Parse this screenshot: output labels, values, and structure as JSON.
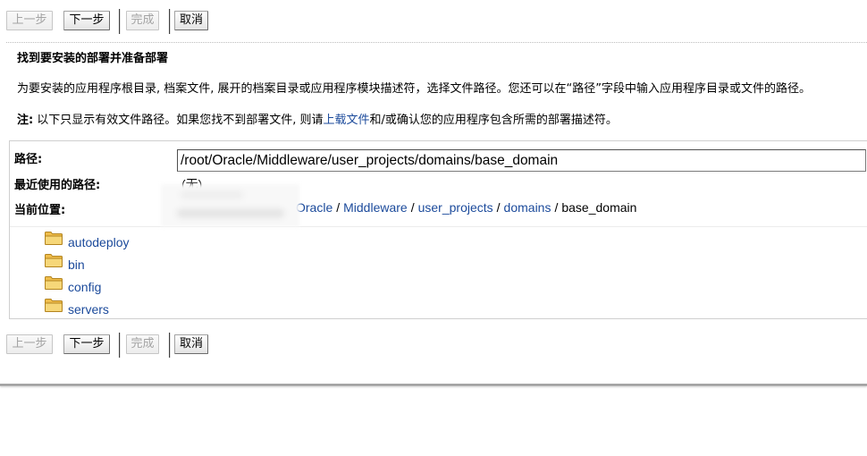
{
  "colors": {
    "link": "#1b4a9b",
    "disabled_text": "#a3a3a3",
    "folder": "#f6d779"
  },
  "toolbar_top": {
    "buttons": [
      {
        "label": "上一步",
        "disabled": true
      },
      {
        "label": "下一步",
        "disabled": false
      },
      {
        "label": "完成",
        "disabled": true
      },
      {
        "label": "取消",
        "disabled": false
      }
    ]
  },
  "header": {
    "title": "找到要安装的部署并准备部署",
    "description": "为要安装的应用程序根目录, 档案文件, 展开的档案目录或应用程序模块描述符，选择文件路径。您还可以在“路径”字段中输入应用程序目录或文件的路径。",
    "note": {
      "label": "注:",
      "text_before_link": "以下只显示有效文件路径。如果您找不到部署文件, 则请",
      "link": "上载文件",
      "text_after_link": "和/或确认您的应用程序包含所需的部署描述符。"
    }
  },
  "file_browser": {
    "path": {
      "label": "路径:",
      "value": "/root/Oracle/Middleware/user_projects/domains/base_domain"
    },
    "recent_paths": {
      "label": "最近使用的路径:",
      "value": "(无)"
    },
    "current_location": {
      "label": "当前位置:",
      "separator": "/",
      "crumbs": [
        {
          "label": "Oracle"
        },
        {
          "label": "Middleware"
        },
        {
          "label": "user_projects"
        },
        {
          "label": "domains"
        },
        {
          "label": "base_domain"
        }
      ]
    },
    "folders": [
      {
        "name": "autodeploy",
        "icon": "folder-icon"
      },
      {
        "name": "bin",
        "icon": "folder-icon"
      },
      {
        "name": "config",
        "icon": "folder-icon"
      },
      {
        "name": "servers",
        "icon": "folder-icon"
      }
    ]
  },
  "toolbar_bottom": {
    "buttons": [
      {
        "label": "上一步",
        "disabled": true
      },
      {
        "label": "下一步",
        "disabled": false
      },
      {
        "label": "完成",
        "disabled": true
      },
      {
        "label": "取消",
        "disabled": false
      }
    ]
  }
}
